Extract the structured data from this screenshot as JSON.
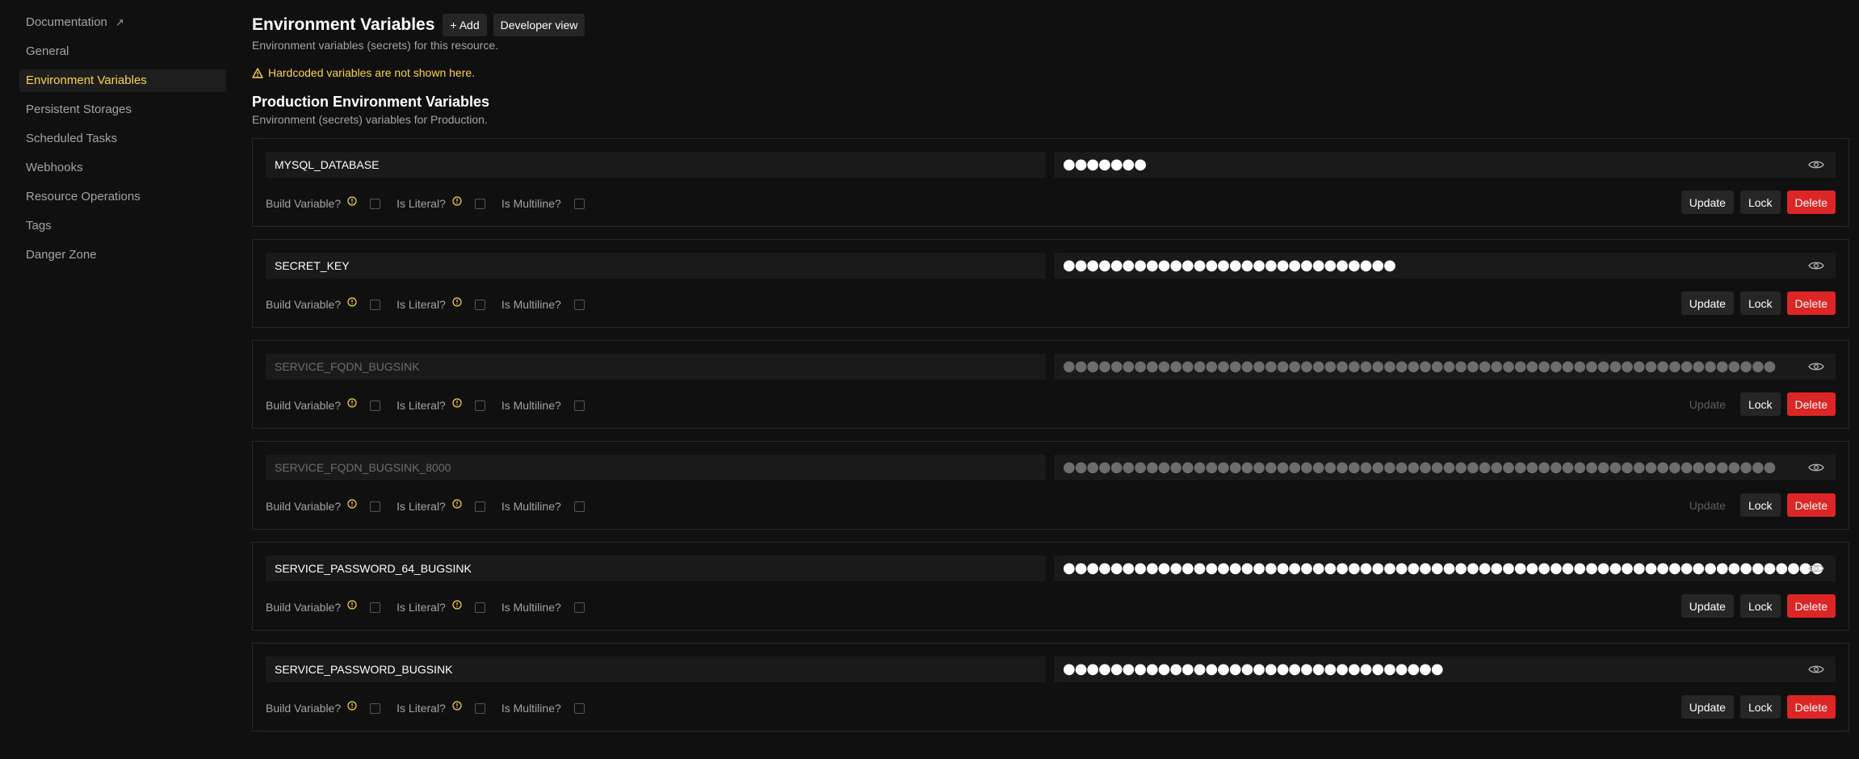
{
  "sidebar": {
    "items": [
      {
        "label": "Documentation",
        "external": true
      },
      {
        "label": "General"
      },
      {
        "label": "Environment Variables",
        "active": true
      },
      {
        "label": "Persistent Storages"
      },
      {
        "label": "Scheduled Tasks"
      },
      {
        "label": "Webhooks"
      },
      {
        "label": "Resource Operations"
      },
      {
        "label": "Tags"
      },
      {
        "label": "Danger Zone"
      }
    ],
    "external_glyph": "↗"
  },
  "header": {
    "title": "Environment Variables",
    "add_label": "+ Add",
    "dev_view_label": "Developer view",
    "subtitle": "Environment variables (secrets) for this resource."
  },
  "warning": {
    "text": "Hardcoded variables are not shown here.",
    "color": "#fcd34d"
  },
  "section": {
    "title": "Production Environment Variables",
    "subtitle": "Environment (secrets) variables for Production."
  },
  "labels": {
    "build": "Build Variable?",
    "literal": "Is Literal?",
    "multiline": "Is Multiline?",
    "update": "Update",
    "lock": "Lock",
    "delete": "Delete"
  },
  "variables": [
    {
      "key": "MYSQL_DATABASE",
      "masked": "●●●●●●●",
      "locked": false
    },
    {
      "key": "SECRET_KEY",
      "masked": "●●●●●●●●●●●●●●●●●●●●●●●●●●●●",
      "locked": false
    },
    {
      "key": "SERVICE_FQDN_BUGSINK",
      "masked": "●●●●●●●●●●●●●●●●●●●●●●●●●●●●●●●●●●●●●●●●●●●●●●●●●●●●●●●●●●●●",
      "locked": true
    },
    {
      "key": "SERVICE_FQDN_BUGSINK_8000",
      "masked": "●●●●●●●●●●●●●●●●●●●●●●●●●●●●●●●●●●●●●●●●●●●●●●●●●●●●●●●●●●●●",
      "locked": true
    },
    {
      "key": "SERVICE_PASSWORD_64_BUGSINK",
      "masked": "●●●●●●●●●●●●●●●●●●●●●●●●●●●●●●●●●●●●●●●●●●●●●●●●●●●●●●●●●●●●●●●●",
      "locked": false
    },
    {
      "key": "SERVICE_PASSWORD_BUGSINK",
      "masked": "●●●●●●●●●●●●●●●●●●●●●●●●●●●●●●●●",
      "locked": false
    }
  ],
  "colors": {
    "accent": "#fcd34d",
    "delete": "#dc2626",
    "background": "#101010"
  },
  "icons": [
    "external-link-icon",
    "warning-icon",
    "info-icon",
    "eye-icon"
  ]
}
